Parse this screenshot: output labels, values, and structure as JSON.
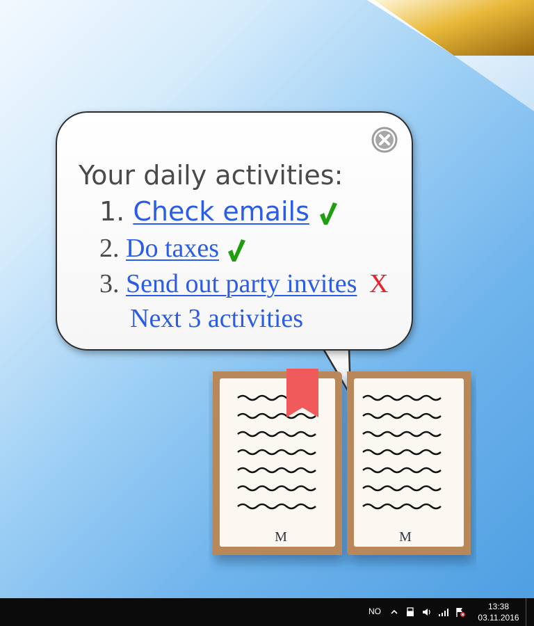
{
  "popup": {
    "heading": "Your daily activities:",
    "items": [
      {
        "number": "1.",
        "label": "Check emails",
        "status": "done"
      },
      {
        "number": "2.",
        "label": "Do taxes",
        "status": "done"
      },
      {
        "number": "3.",
        "label": "Send out party invites",
        "status": "not-done",
        "status_mark": "X"
      }
    ],
    "next_link": "Next 3 activities",
    "close_icon": "close-icon",
    "check_icon": "check-icon",
    "colors": {
      "link": "#2a5ce6",
      "check": "#1f9e0f",
      "cross": "#e3242b",
      "heading": "#4a4a4a"
    }
  },
  "book": {
    "left_page_letter": "M",
    "right_page_letter": "M",
    "bookmark_color": "#f05a5a",
    "cover_color": "#b8875a"
  },
  "taskbar": {
    "language": "NO",
    "time": "13:38",
    "date": "03.11.2016",
    "tray_icons": [
      "chevron-up-icon",
      "usb-icon",
      "volume-icon",
      "signal-icon",
      "flag-alert-icon"
    ]
  }
}
